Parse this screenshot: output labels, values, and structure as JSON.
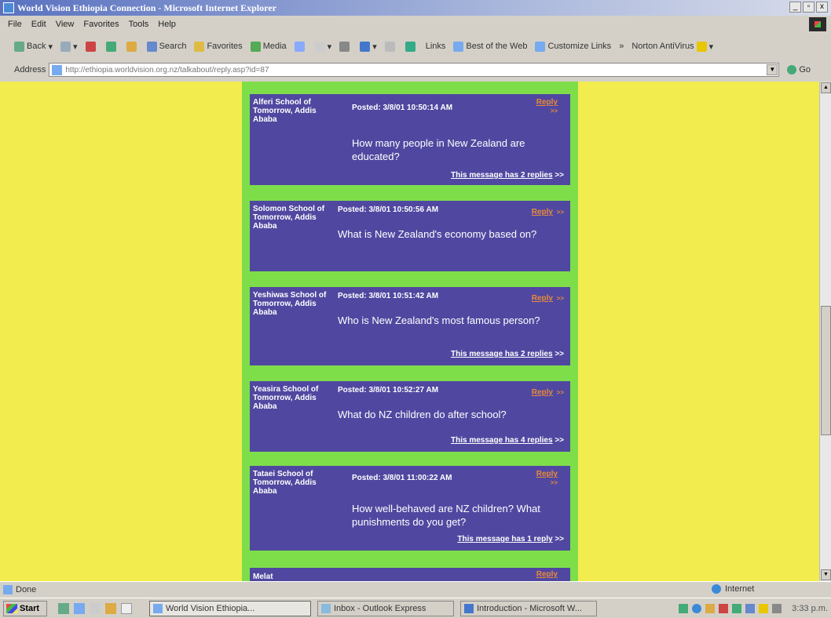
{
  "window": {
    "title": "World Vision Ethiopia Connection - Microsoft Internet Explorer",
    "controls": [
      "_",
      "▫",
      "x"
    ]
  },
  "menu": [
    "File",
    "Edit",
    "View",
    "Favorites",
    "Tools",
    "Help"
  ],
  "toolbar": {
    "back": "Back",
    "search": "Search",
    "favorites": "Favorites",
    "media": "Media",
    "links": "Links",
    "best_of_web": "Best of the Web",
    "customize_links": "Customize Links",
    "chevron": "»",
    "norton": "Norton AntiVirus"
  },
  "address": {
    "label": "Address",
    "url": "http://ethiopia.worldvision.org.nz/talkabout/reply.asp?id=87",
    "go": "Go"
  },
  "messages": [
    {
      "author": "Alferi School of Tomorrow, Addis Ababa",
      "posted": "Posted: 3/8/01 10:50:14 AM",
      "reply": "Reply",
      "reply_arrows": ">>",
      "question": "How many people in New Zealand are educated?",
      "replies_link": "This message has 2 replies",
      "replies_arrows": ">>"
    },
    {
      "author": "Solomon School of Tomorrow, Addis Ababa",
      "posted": "Posted: 3/8/01 10:50:56 AM",
      "reply": "Reply",
      "reply_arrows": ">>",
      "question": "What is New Zealand's economy based on?"
    },
    {
      "author": "Yeshiwas School of Tomorrow, Addis Ababa",
      "posted": "Posted: 3/8/01 10:51:42 AM",
      "reply": "Reply",
      "reply_arrows": ">>",
      "question": "Who is New Zealand's most famous person?",
      "replies_link": "This message has 2 replies",
      "replies_arrows": ">>"
    },
    {
      "author": "Yeasira School of Tomorrow, Addis Ababa",
      "posted": "Posted: 3/8/01 10:52:27 AM",
      "reply": "Reply",
      "reply_arrows": ">>",
      "question": "What do NZ children do after school?",
      "replies_link": "This message has 4 replies",
      "replies_arrows": ">>"
    },
    {
      "author": "Tataei School of Tomorrow, Addis Ababa",
      "posted": "Posted: 3/8/01 11:00:22 AM",
      "reply": "Reply",
      "reply_arrows": ">>",
      "question": "How well-behaved are NZ children? What punishments do you get?",
      "replies_link": "This message has 1 reply",
      "replies_arrows": ">>"
    },
    {
      "author": "Melat",
      "reply": "Reply"
    }
  ],
  "status": {
    "text": "Done",
    "zone": "Internet"
  },
  "taskbar": {
    "start": "Start",
    "tasks": [
      "World Vision Ethiopia...",
      "Inbox - Outlook Express",
      "Introduction - Microsoft W..."
    ],
    "clock": "3:33 p.m."
  }
}
